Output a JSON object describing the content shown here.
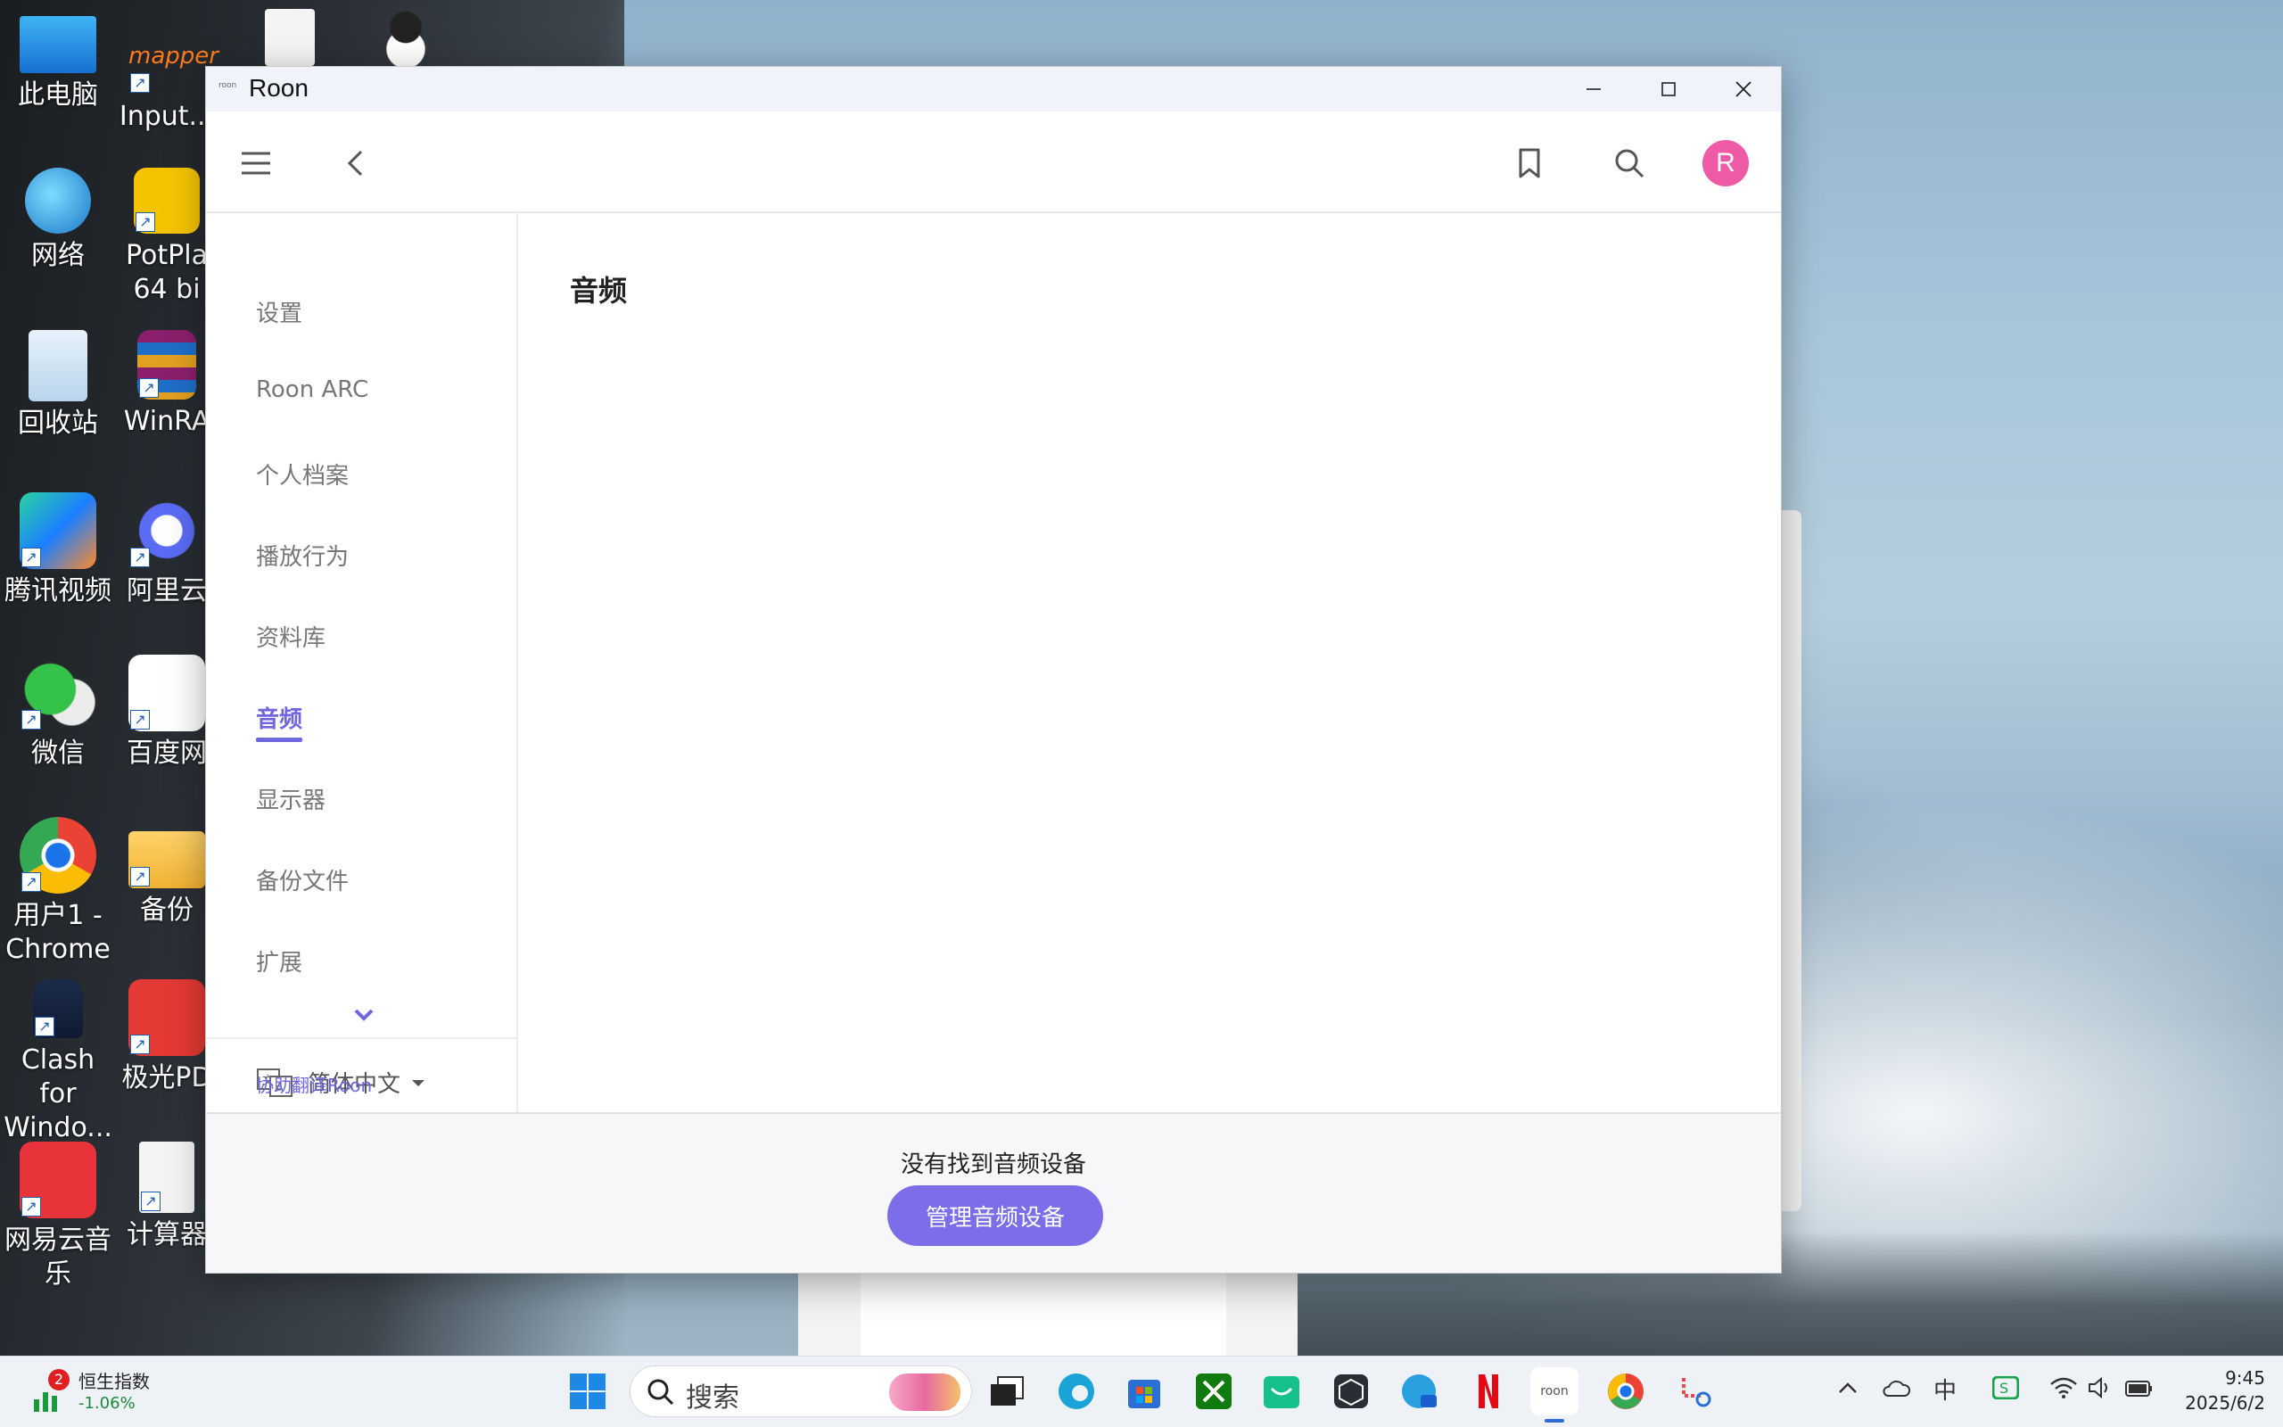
{
  "desktop": {
    "icons": [
      {
        "label": "此电脑"
      },
      {
        "label": "网络"
      },
      {
        "label": "回收站"
      },
      {
        "label": "腾讯视频"
      },
      {
        "label": "微信"
      },
      {
        "label": "用户1 - Chrome"
      },
      {
        "label": "Clash for Windo..."
      },
      {
        "label": "网易云音乐"
      },
      {
        "label": "Input..."
      },
      {
        "label": "PotPla 64 bi"
      },
      {
        "label": "WinRA"
      },
      {
        "label": "阿里云"
      },
      {
        "label": "百度网"
      },
      {
        "label": "备份"
      },
      {
        "label": "极光PD"
      },
      {
        "label": "计算器"
      }
    ]
  },
  "window": {
    "title": "Roon",
    "app_icon_text": "roon",
    "controls": {
      "minimize": "—",
      "maximize": "☐",
      "close": "✕"
    }
  },
  "topbar": {
    "avatar_letter": "R"
  },
  "sidebar": {
    "items": [
      {
        "label": "设置"
      },
      {
        "label": "Roon ARC"
      },
      {
        "label": "个人档案"
      },
      {
        "label": "播放行为"
      },
      {
        "label": "资料库"
      },
      {
        "label": "音频"
      },
      {
        "label": "显示器"
      },
      {
        "label": "备份文件"
      },
      {
        "label": "扩展"
      }
    ],
    "active_index": 5,
    "language": "简体中文",
    "help_translate": "协助翻译Roon"
  },
  "main": {
    "title": "音频"
  },
  "footer": {
    "message": "没有找到音频设备",
    "button": "管理音频设备"
  },
  "taskbar": {
    "stock_name": "恒生指数",
    "stock_change": "-1.06%",
    "stock_badge": "2",
    "search_label": "搜索",
    "time": "9:45",
    "date": "2025/6/2",
    "ime": "中"
  },
  "colors": {
    "accent": "#7066e0",
    "button": "#7b6ee8",
    "avatar": "#ee5aa6"
  }
}
